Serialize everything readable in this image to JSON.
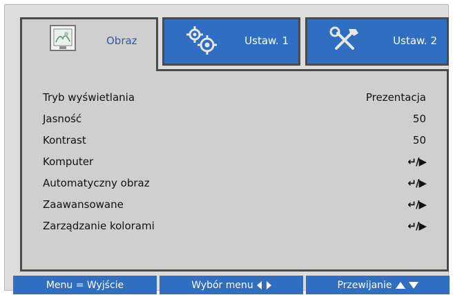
{
  "tabs": [
    {
      "label": "Obraz",
      "icon": "picture-icon",
      "active": true
    },
    {
      "label": "Ustaw. 1",
      "icon": "gears-icon",
      "active": false
    },
    {
      "label": "Ustaw. 2",
      "icon": "tools-icon",
      "active": false
    }
  ],
  "menu": {
    "items": [
      {
        "label": "Tryb wyświetlania",
        "value": "Prezentacja"
      },
      {
        "label": "Jasność",
        "value": "50"
      },
      {
        "label": "Kontrast",
        "value": "50"
      },
      {
        "label": "Komputer",
        "value": "↵/▶"
      },
      {
        "label": "Automatyczny obraz",
        "value": "↵/▶"
      },
      {
        "label": "Zaawansowane",
        "value": "↵/▶"
      },
      {
        "label": "Zarządzanie kolorami",
        "value": "↵/▶"
      }
    ]
  },
  "footer": {
    "exit_label": "Menu = Wyjście",
    "select_label": "Wybór menu",
    "scroll_label": "Przewijanie"
  },
  "colors": {
    "accent_blue": "#2f6ec1",
    "panel_gray": "#cfcfcf",
    "border_dark": "#4a4a4a"
  }
}
